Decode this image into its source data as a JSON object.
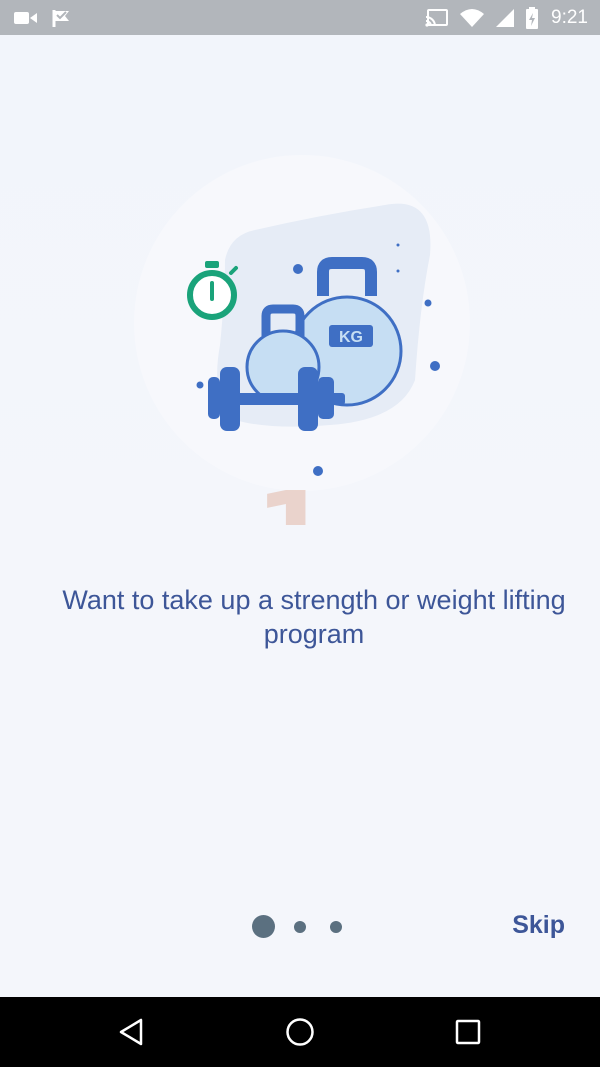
{
  "status_bar": {
    "time": "9:21",
    "left_icons": [
      "video-camera-icon",
      "flag-notification-icon"
    ],
    "right_icons": [
      "cast-icon",
      "wifi-icon",
      "signal-icon",
      "battery-icon"
    ]
  },
  "onboarding": {
    "step_number": "1",
    "headline": "Want to take up a strength or weight lifting program",
    "illustration": {
      "kettlebell_label": "KG",
      "icons": [
        "stopwatch-icon",
        "kettlebell-icon",
        "dumbbell-icon"
      ]
    },
    "page_indicator": {
      "total": 3,
      "active_index": 0
    },
    "skip_label": "Skip"
  },
  "navigation_bar": {
    "buttons": [
      "back-icon",
      "home-icon",
      "recents-icon"
    ]
  },
  "colors": {
    "status_bar": "#b2b6bb",
    "background": "#f3f6fb",
    "accent_text": "#3d5698",
    "illustration_blue": "#3f6fc4",
    "illustration_light_blue": "#c6def3",
    "stopwatch_green": "#1aa37a",
    "dot_color": "#5b7080",
    "step_number": "#e7c8bd"
  }
}
